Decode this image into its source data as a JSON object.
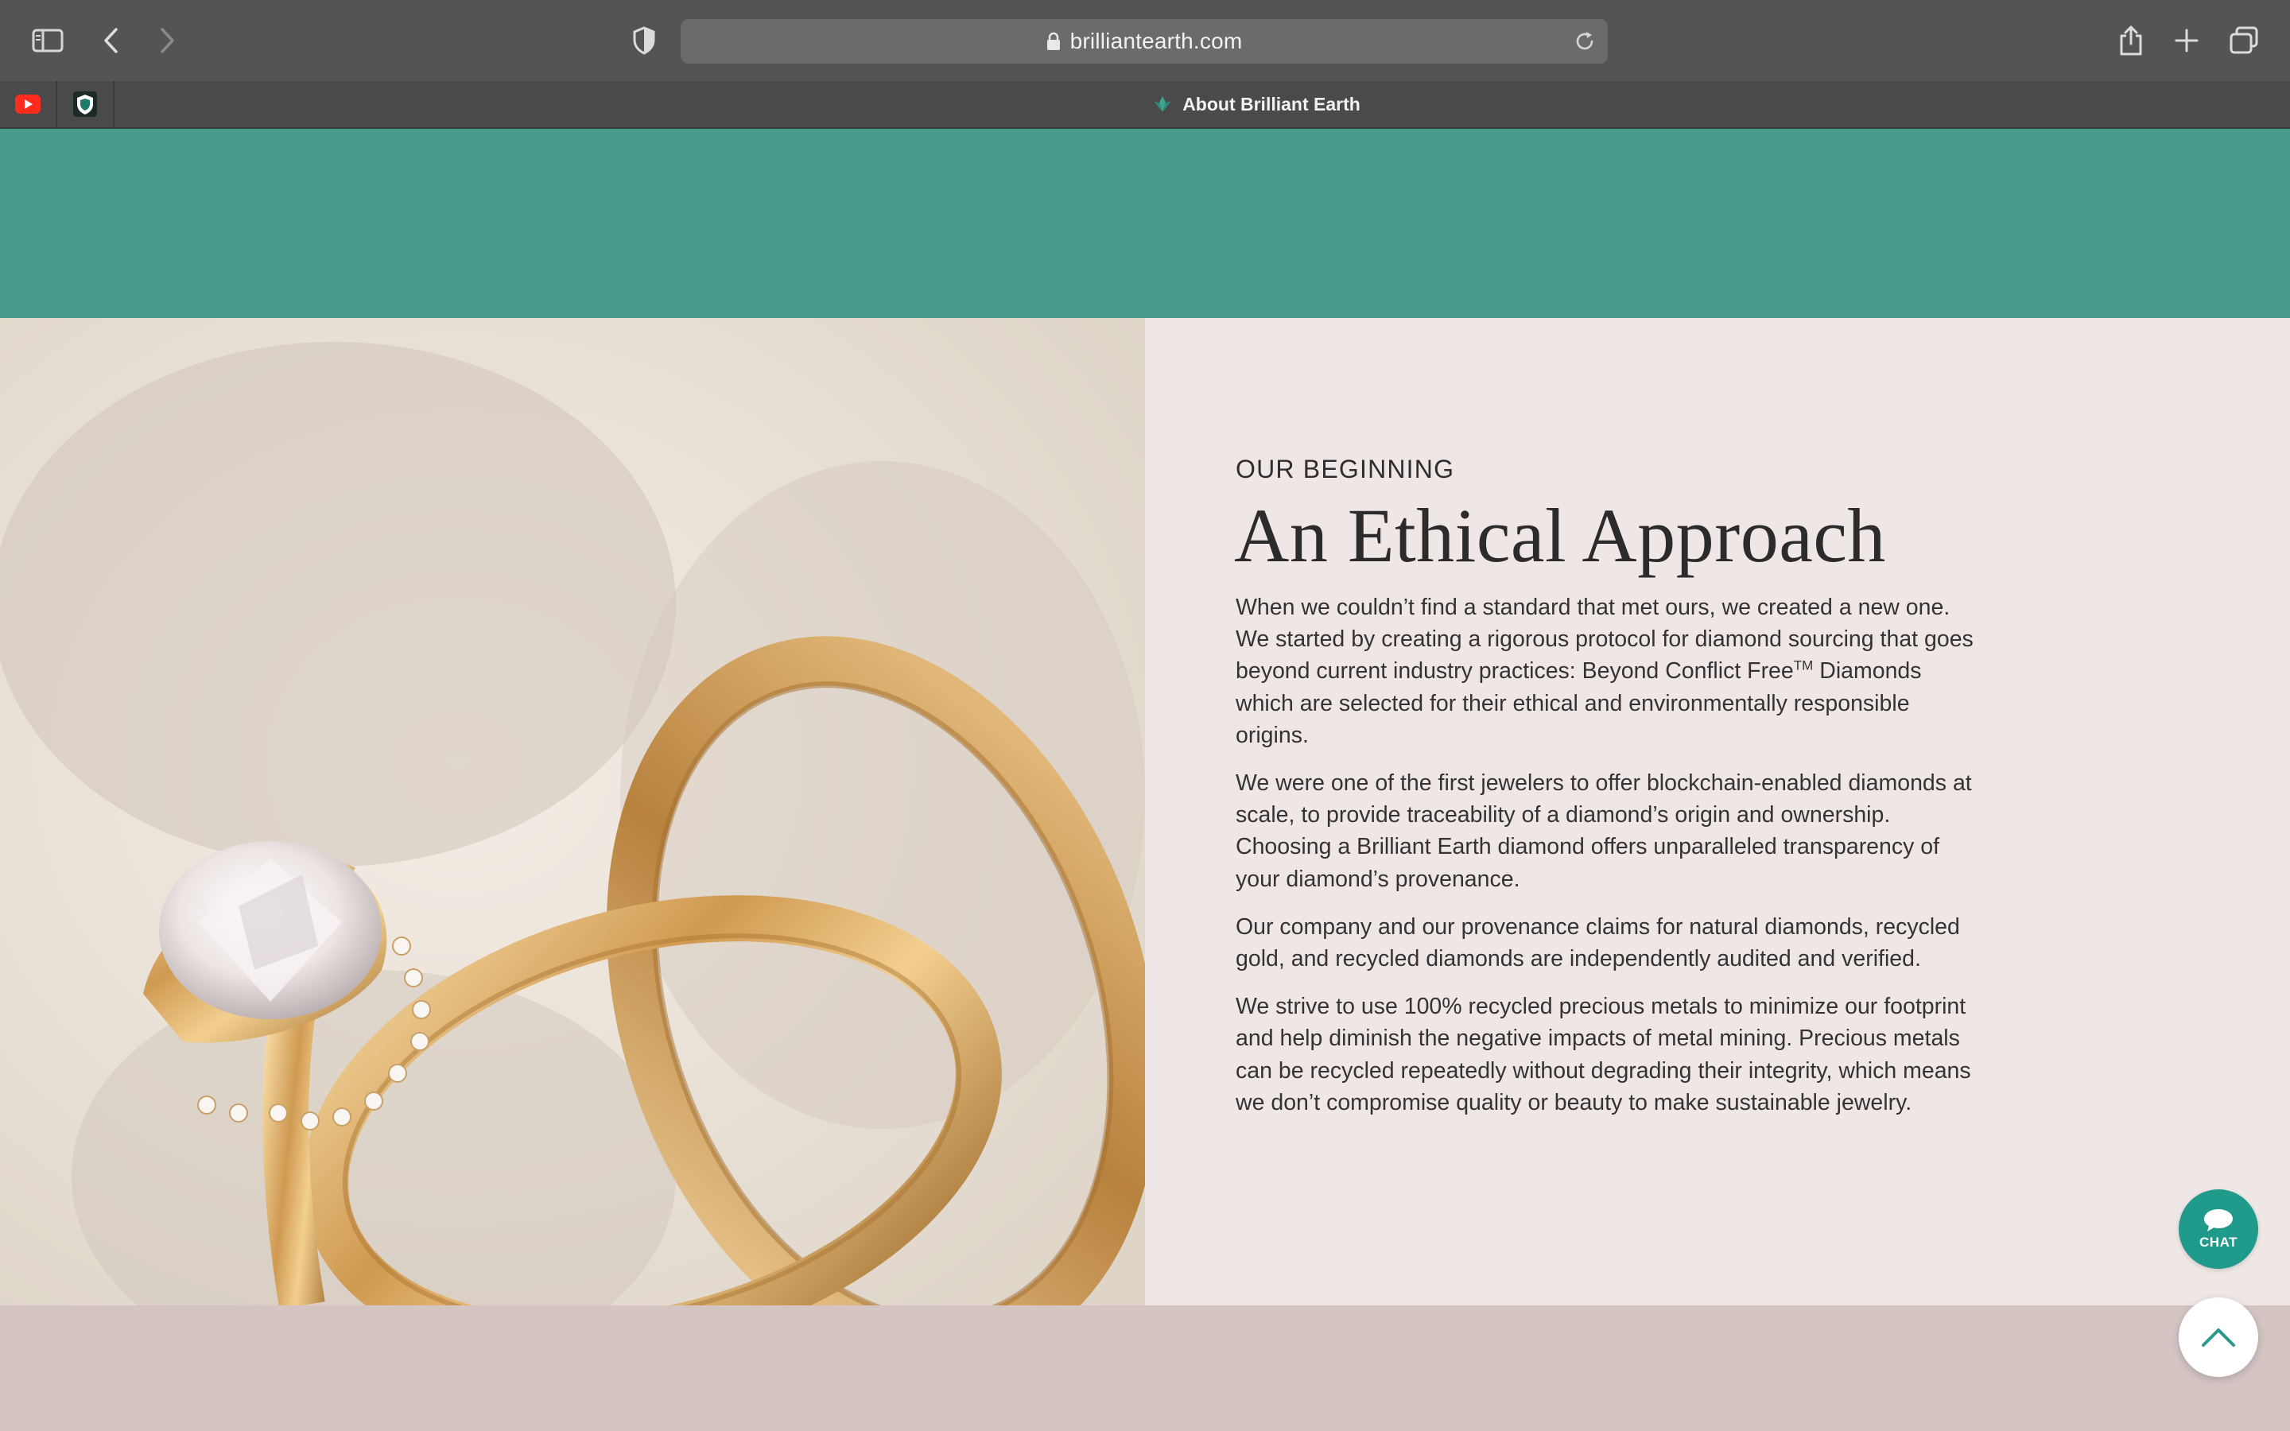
{
  "browser": {
    "url": "brilliantearth.com",
    "active_tab_title": "About Brilliant Earth",
    "pinned_tabs": [
      "youtube-icon",
      "shield-crest-icon"
    ]
  },
  "section": {
    "eyebrow": "OUR BEGINNING",
    "headline": "An Ethical Approach",
    "p1_a": "When we couldn’t find a standard that met ours, we created a new one. We started by creating a rigorous protocol for diamond sourcing that goes beyond current industry practices: Beyond Conflict Free",
    "p1_tm": "TM",
    "p1_b": " Diamonds which are selected for their ethical and environmentally responsible origins.",
    "p2": "We were one of the first jewelers to offer blockchain-enabled diamonds at scale, to provide traceability of a diamond’s origin and ownership. Choosing a Brilliant Earth diamond offers unparalleled transparency of your diamond’s provenance.",
    "p3": "Our company and our provenance claims for natural diamonds, recycled gold, and recycled diamonds are independently audited and verified.",
    "p4": "We strive to use 100% recycled precious metals to minimize our footprint and help diminish the negative impacts of metal mining. Precious metals can be recycled repeatedly without degrading their integrity, which means we don’t compromise quality or beauty to make sustainable jewelry."
  },
  "widgets": {
    "chat_label": "CHAT"
  },
  "colors": {
    "teal_band": "#469b8d",
    "chat_button": "#1f9a8b",
    "panel_bg": "#efe7e5",
    "bottom_band": "#d4c5c3"
  }
}
